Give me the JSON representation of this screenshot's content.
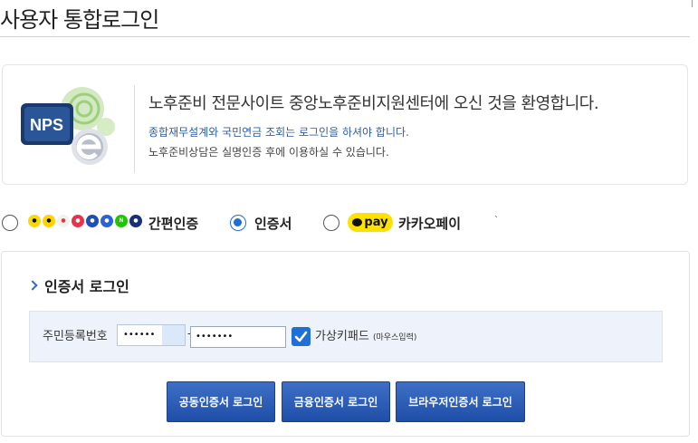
{
  "page": {
    "title": "사용자 통합로그인"
  },
  "welcome": {
    "logo_text": "NPS",
    "heading": "노후준비 전문사이트 중앙노후준비지원센터에 오신 것을 환영합니다.",
    "line1": "종합재무설계와 국민연금 조회는 로그인을 하셔야 합니다.",
    "line2": "노후준비상담은 실명인증 후에 이용하실 수 있습니다."
  },
  "login_options": {
    "easy_auth": {
      "label": "간편인증",
      "selected": false,
      "provider_icons": [
        "kakao-icon",
        "toss-icon",
        "payco-icon",
        "pass-icon",
        "samsung-pass-icon",
        "kb-icon",
        "naver-icon",
        "shinhan-icon"
      ]
    },
    "certificate": {
      "label": "인증서",
      "selected": true
    },
    "kakaopay": {
      "label": "카카오페이",
      "badge_text": "pay",
      "selected": false
    }
  },
  "cert_login": {
    "title": "인증서 로그인",
    "id_label": "주민등록번호",
    "id_part1_value": "••••••",
    "id_separator": "-",
    "id_part2_value": "•••••••",
    "virtual_keypad_checked": true,
    "virtual_keypad_label": "가상키패드",
    "virtual_keypad_sub": "(마우스입력)",
    "buttons": {
      "joint": "공동인증서 로그인",
      "financial": "금융인증서 로그인",
      "browser": "브라우저인증서 로그인"
    }
  },
  "colors": {
    "accent": "#1f6fd6",
    "button": "#2a57b0",
    "info_text": "#2d5fa8",
    "kakaopay_yellow": "#ffe100"
  }
}
